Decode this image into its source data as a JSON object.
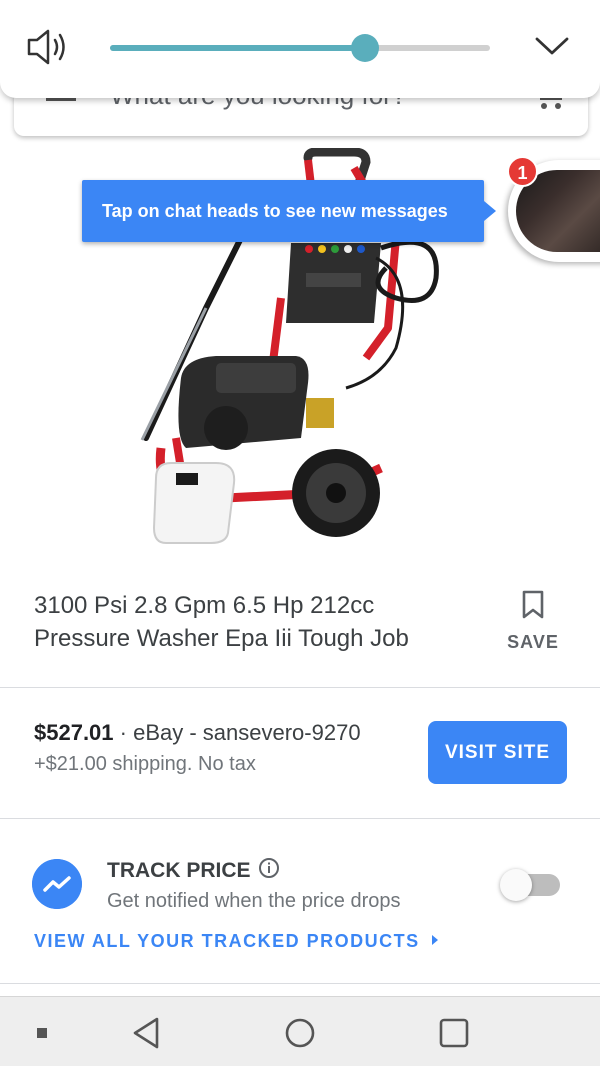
{
  "search": {
    "placeholder": "What are you looking for?"
  },
  "volume": {
    "level": 0.67,
    "accent_color": "#5aaebc"
  },
  "chat_head": {
    "tooltip": "Tap on chat heads to see new messages",
    "badge_count": "1",
    "accent_color": "#3b86f5"
  },
  "product": {
    "title": "3100 Psi 2.8 Gpm 6.5 Hp 212cc Pressure Washer Epa Iii Tough Job",
    "save_label": "SAVE",
    "price": "$527.01",
    "seller": " · eBay - sansevero-9270",
    "shipping": "+$21.00 shipping. No tax",
    "visit_label": "VISIT SITE"
  },
  "track": {
    "title": "TRACK PRICE",
    "subtitle": "Get notified when the price drops",
    "toggle_on": false,
    "view_all_label": "VIEW ALL YOUR TRACKED PRODUCTS"
  },
  "nav": {
    "items": [
      "square-dot-icon",
      "back-icon",
      "home-icon",
      "recents-icon"
    ]
  }
}
